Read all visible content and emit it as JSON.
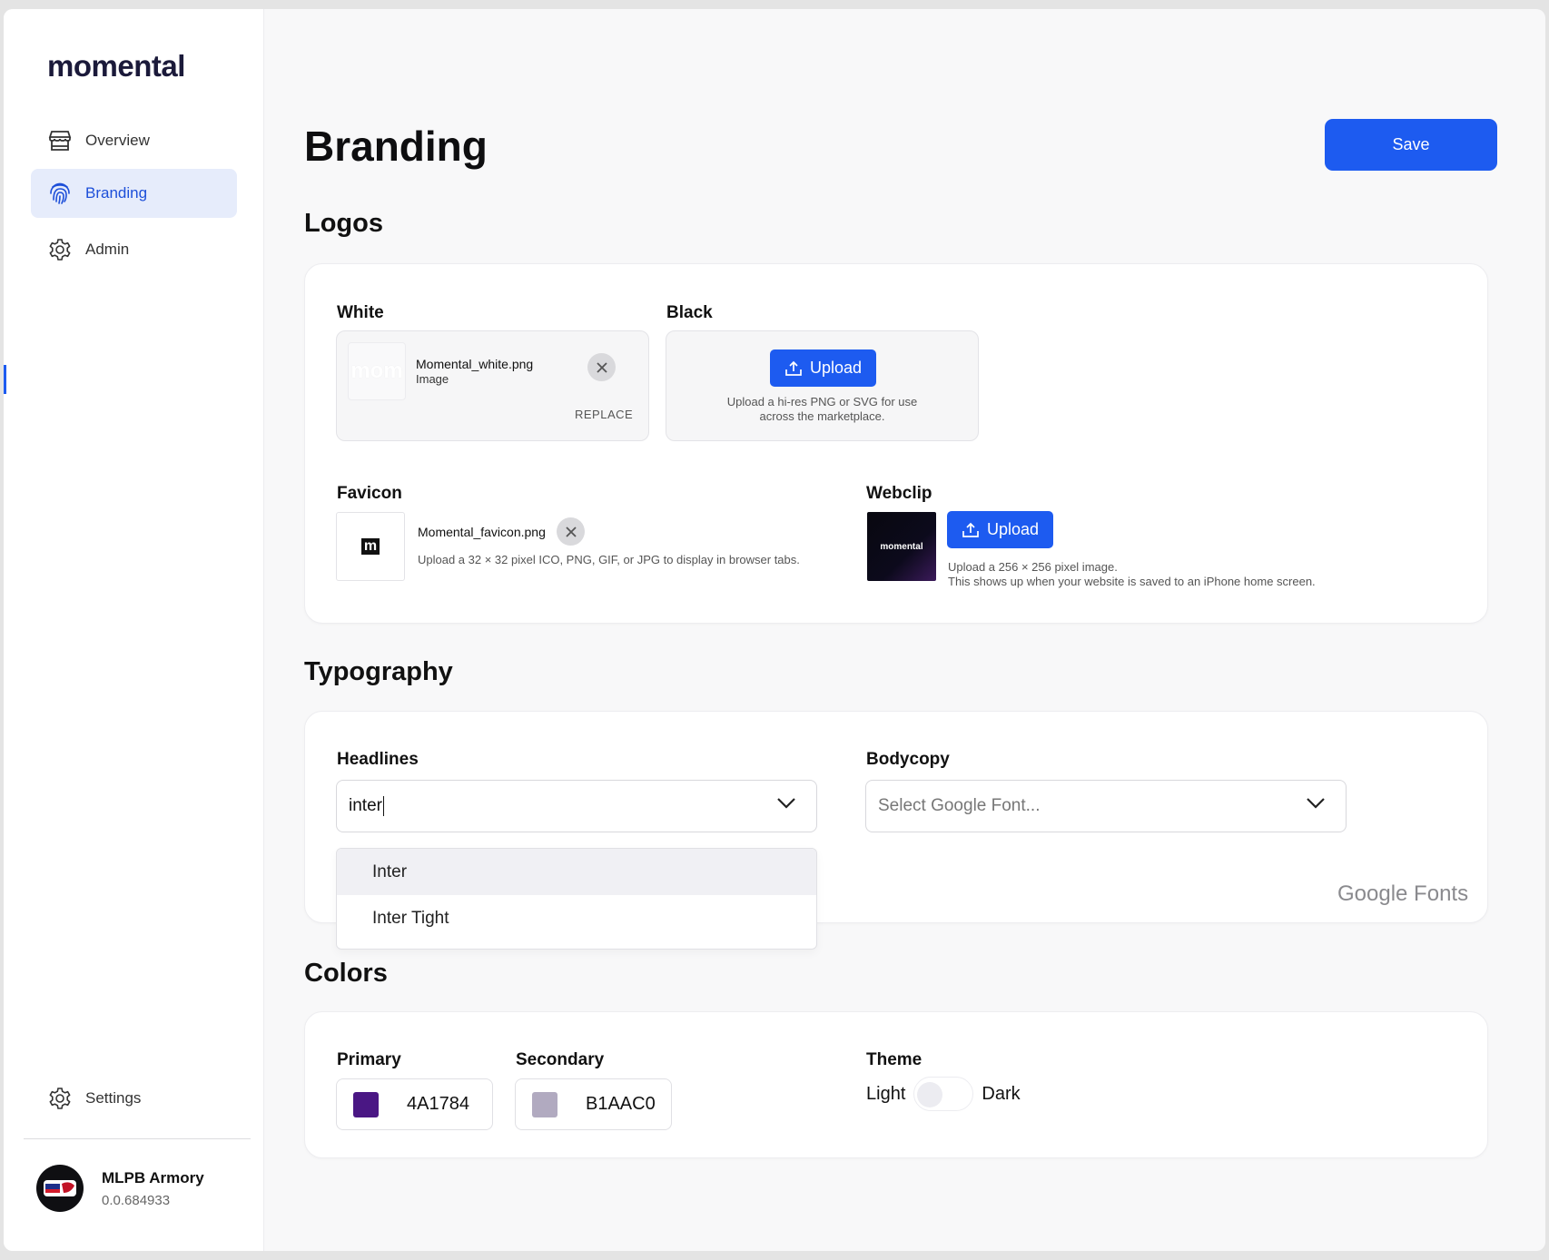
{
  "sidebar": {
    "logo": "momental",
    "nav": [
      {
        "label": "Overview",
        "icon": "storefront-icon"
      },
      {
        "label": "Branding",
        "icon": "fingerprint-icon",
        "active": true
      },
      {
        "label": "Admin",
        "icon": "gear-icon"
      }
    ],
    "settings_label": "Settings",
    "user": {
      "name": "MLPB Armory",
      "version": "0.0.684933"
    }
  },
  "page": {
    "title": "Branding",
    "save_label": "Save"
  },
  "logos": {
    "section_title": "Logos",
    "white": {
      "label": "White",
      "file_name": "Momental_white.png",
      "file_type": "Image",
      "replace_label": "REPLACE",
      "thumb_text": "mom"
    },
    "black": {
      "label": "Black",
      "upload_label": "Upload",
      "helper_line1": "Upload a hi-res PNG or SVG for use",
      "helper_line2": "across the marketplace."
    },
    "favicon": {
      "label": "Favicon",
      "file_name": "Momental_favicon.png",
      "helper": "Upload a 32 × 32 pixel ICO, PNG, GIF, or JPG to display in browser tabs.",
      "thumb_text": "m"
    },
    "webclip": {
      "label": "Webclip",
      "upload_label": "Upload",
      "thumb_text": "momental",
      "helper_line1": "Upload a 256 × 256 pixel image.",
      "helper_line2": "This shows up when your website is saved to an iPhone home screen."
    }
  },
  "typography": {
    "section_title": "Typography",
    "headlines": {
      "label": "Headlines",
      "value": "inter",
      "options": [
        "Inter",
        "Inter Tight"
      ],
      "highlighted_index": 0
    },
    "bodycopy": {
      "label": "Bodycopy",
      "placeholder": "Select Google Font..."
    },
    "attribution": "Google Fonts"
  },
  "colors": {
    "section_title": "Colors",
    "primary": {
      "label": "Primary",
      "hex": "4A1784",
      "swatch": "#4A1784"
    },
    "secondary": {
      "label": "Secondary",
      "hex": "B1AAC0",
      "swatch": "#B1AAC0"
    },
    "theme": {
      "label": "Theme",
      "light_label": "Light",
      "dark_label": "Dark",
      "dark_enabled": false
    }
  },
  "accent": "#1D5BF0"
}
